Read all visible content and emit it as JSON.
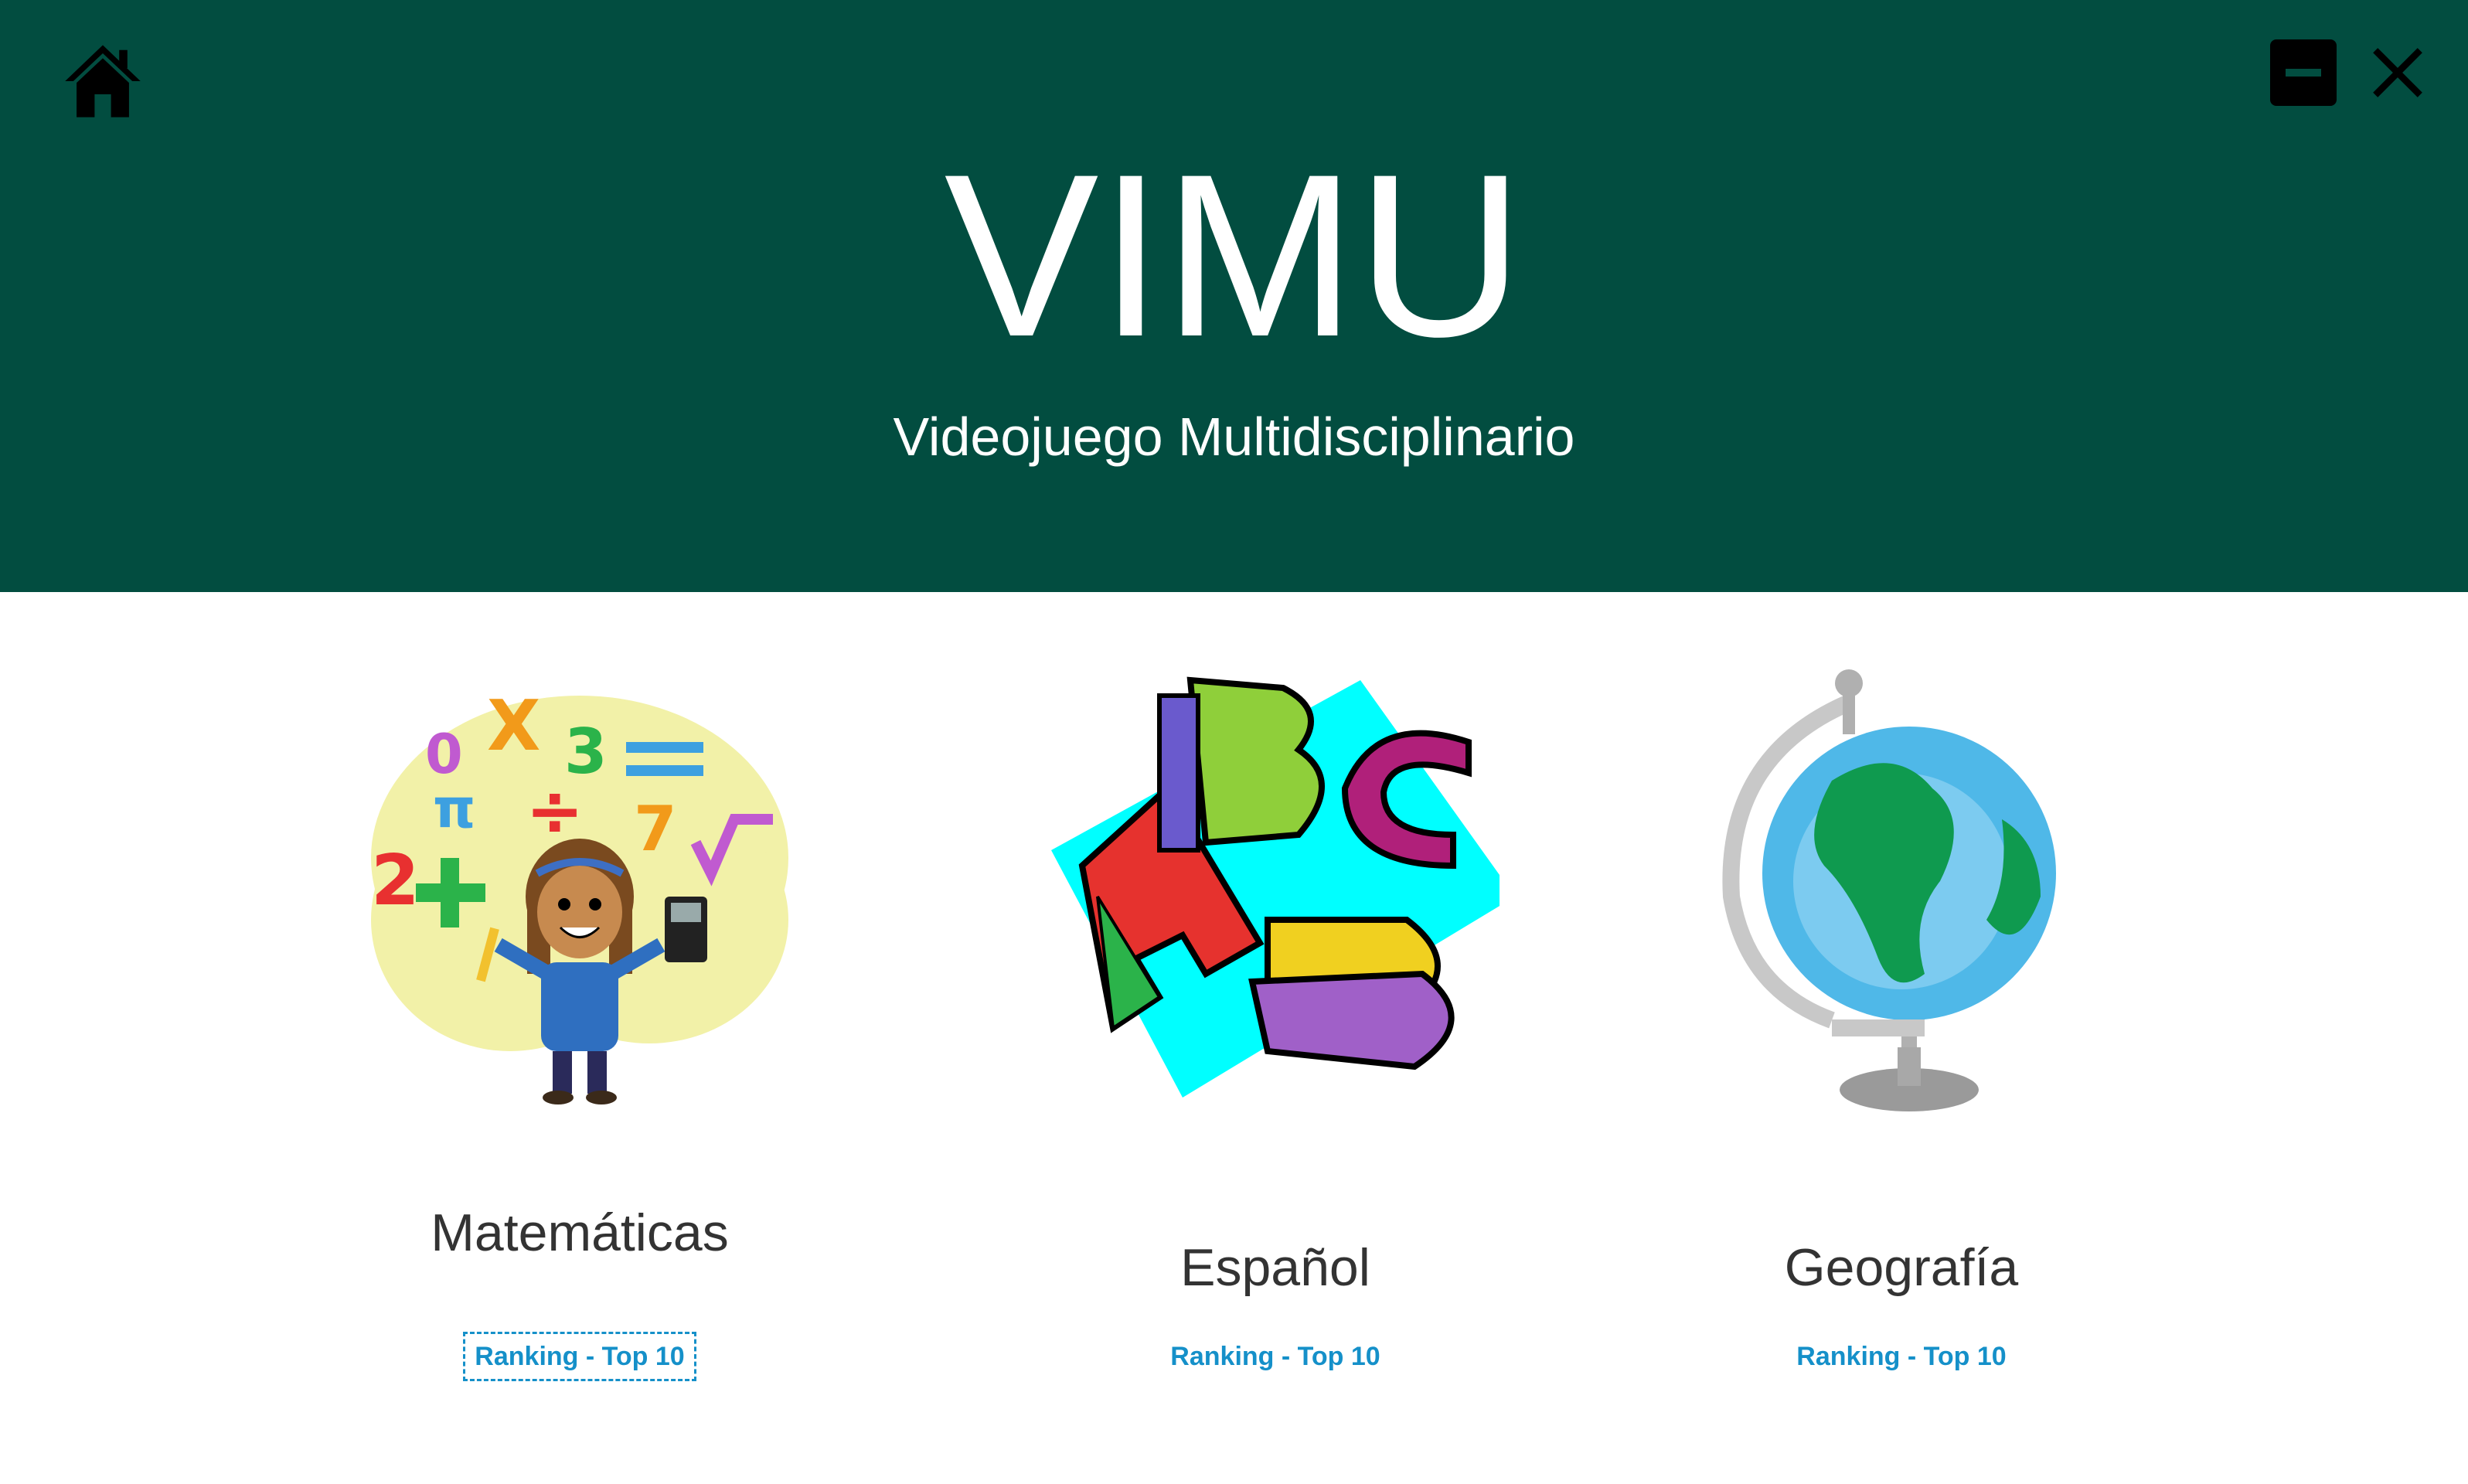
{
  "header": {
    "title": "VIMU",
    "subtitle": "Videojuego Multidisciplinario",
    "home_icon": "home-icon",
    "minimize_icon": "minimize-icon",
    "close_icon": "close-icon"
  },
  "subjects": [
    {
      "name": "Matemáticas",
      "ranking_link": "Ranking - Top 10",
      "illustration": "math-girl-icon",
      "focused": true
    },
    {
      "name": "Español",
      "ranking_link": "Ranking - Top 10",
      "illustration": "abc-letters-icon"
    },
    {
      "name": "Geografía",
      "ranking_link": "Ranking - Top 10",
      "illustration": "globe-icon"
    }
  ],
  "colors": {
    "header_bg": "#024d40",
    "title_text": "#ffffff",
    "subject_text": "#333333",
    "link_text": "#1590c9"
  }
}
